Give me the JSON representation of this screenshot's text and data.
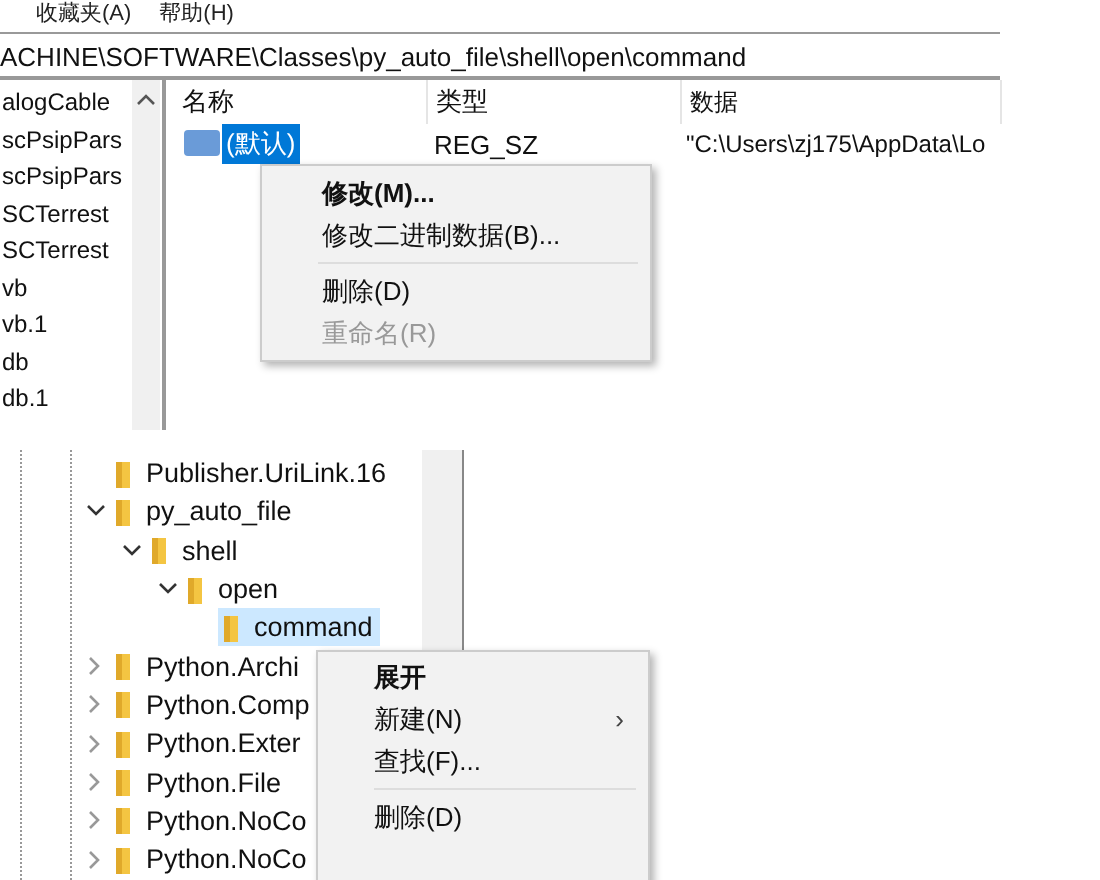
{
  "top_window": {
    "menu_bar": [
      "收藏夹(A)",
      "帮助(H)"
    ],
    "address": "ACHINE\\SOFTWARE\\Classes\\py_auto_file\\shell\\open\\command",
    "tree_items": [
      "alogCable",
      "scPsipPars",
      "scPsipPars",
      "SCTerrest",
      "SCTerrest",
      "vb",
      "vb.1",
      "db",
      "db.1"
    ],
    "list": {
      "columns": [
        "名称",
        "类型",
        "数据"
      ],
      "rows": [
        {
          "name": "(默认)",
          "type": "REG_SZ",
          "data": "\"C:\\Users\\zj175\\AppData\\Lo",
          "selected": true
        }
      ]
    },
    "context_menu": [
      {
        "kind": "item",
        "label": "修改(M)...",
        "default": true,
        "disabled": false
      },
      {
        "kind": "item",
        "label": "修改二进制数据(B)...",
        "default": false,
        "disabled": false
      },
      {
        "kind": "separator"
      },
      {
        "kind": "item",
        "label": "删除(D)",
        "default": false,
        "disabled": false
      },
      {
        "kind": "item",
        "label": "重命名(R)",
        "default": false,
        "disabled": true
      }
    ]
  },
  "bottom_window": {
    "tree": [
      {
        "label": "Publisher.UriLink.16",
        "selected": false
      },
      {
        "label": "py_auto_file",
        "selected": false,
        "expanded": true,
        "children": [
          {
            "label": "shell",
            "selected": false,
            "expanded": true,
            "children": [
              {
                "label": "open",
                "selected": false,
                "expanded": true,
                "children": [
                  {
                    "label": "command",
                    "selected": true
                  }
                ]
              }
            ]
          }
        ]
      },
      {
        "label": "Python.Archi",
        "selected": false,
        "expanded": false
      },
      {
        "label": "Python.Comp",
        "selected": false,
        "expanded": false
      },
      {
        "label": "Python.Exter",
        "selected": false,
        "expanded": false
      },
      {
        "label": "Python.File",
        "selected": false,
        "expanded": false
      },
      {
        "label": "Python.NoCo",
        "selected": false,
        "expanded": false
      },
      {
        "label": "Python.NoCo",
        "selected": false,
        "expanded": false
      }
    ],
    "context_menu": [
      {
        "kind": "item",
        "label": "展开",
        "default": true,
        "disabled": false
      },
      {
        "kind": "submenu",
        "label": "新建(N)",
        "arrow": "›",
        "default": false,
        "disabled": false
      },
      {
        "kind": "item",
        "label": "查找(F)...",
        "default": false,
        "disabled": false
      },
      {
        "kind": "separator"
      },
      {
        "kind": "item",
        "label": "删除(D)",
        "default": false,
        "disabled": false
      }
    ]
  }
}
